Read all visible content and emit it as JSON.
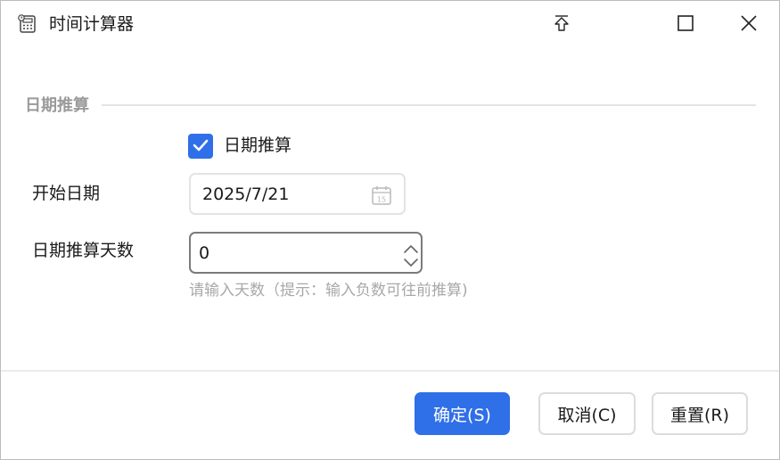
{
  "window": {
    "title": "时间计算器",
    "app_icon": "calculator-icon",
    "controls": [
      "pin-icon",
      "maximize-icon",
      "close-icon"
    ]
  },
  "section": {
    "title": "日期推算"
  },
  "checkbox": {
    "label": "日期推算",
    "checked": true
  },
  "form": {
    "start_date_label": "开始日期",
    "start_date_value": "2025/7/21",
    "calendar_icon_day": "15",
    "days_label": "日期推算天数",
    "days_value": "0",
    "days_hint": "请输入天数（提示：输入负数可往前推算)"
  },
  "footer": {
    "ok_label": "确定(S)",
    "cancel_label": "取消(C)",
    "reset_label": "重置(R)"
  },
  "colors": {
    "accent": "#2f6fe8",
    "section_title": "#9a9a9a",
    "hint": "#a8a8a8"
  }
}
